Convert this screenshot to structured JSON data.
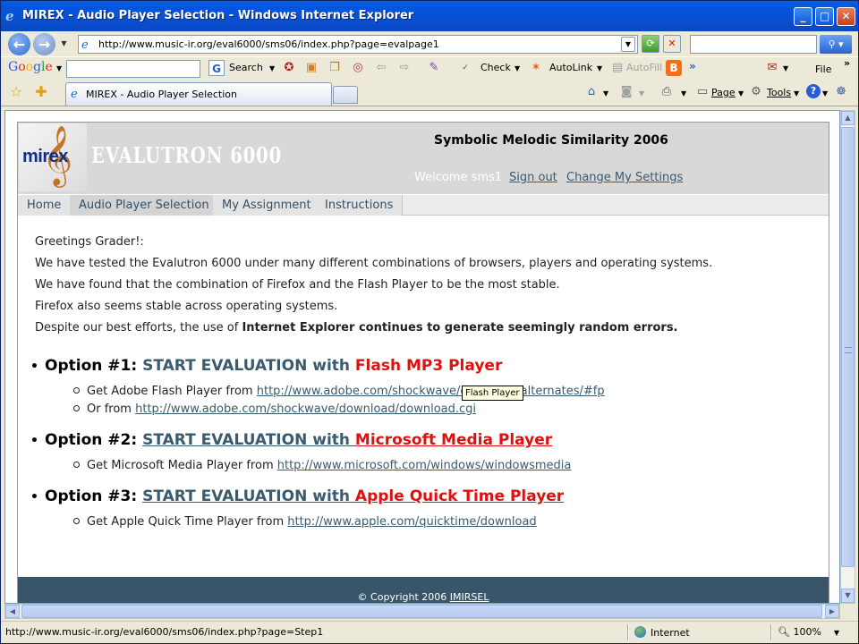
{
  "window": {
    "title": "MIREX - Audio Player Selection - Windows Internet Explorer"
  },
  "address_bar": {
    "url": "http://www.music-ir.org/eval6000/sms06/index.php?page=evalpage1"
  },
  "google_toolbar": {
    "logo": "Google",
    "search_label": "Search",
    "check_label": "Check",
    "autolink_label": "AutoLink",
    "autofill_label": "AutoFill",
    "more": "»",
    "file_label": "File"
  },
  "tabs": {
    "active_tab_label": "MIREX - Audio Player Selection"
  },
  "commands": {
    "page_label": "Page",
    "tools_label": "Tools"
  },
  "site": {
    "logo_text": "mirex",
    "brand": "EVALUTRON 6000",
    "title": "Symbolic Melodic Similarity 2006",
    "welcome": "Welcome sms1",
    "sign_out": "Sign out",
    "change_settings": "Change My Settings",
    "nav": [
      "Home",
      "Audio Player Selection",
      "My Assignment",
      "Instructions"
    ]
  },
  "content": {
    "greeting": "Greetings Grader!:",
    "line1": "We have tested the Evalutron 6000 under many different combinations of browsers, players and operating systems.",
    "line2": "We have found that the combination of Firefox and the Flash Player to be the most stable.",
    "line3": "Firefox also seems stable across operating systems.",
    "line4_prefix": "Despite our best efforts, the use of ",
    "line4_bold": "Internet Explorer continues to generate seemingly random errors.",
    "option1": {
      "label": "Option #1: ",
      "start": "START EVALUATION with ",
      "player": "Flash MP3 Player",
      "sub1_text": "Get Adobe Flash Player from ",
      "sub1_link": "http://www.adobe.com/shockwave/download/alternates/#fp",
      "sub2_text": "Or from ",
      "sub2_link": "http://www.adobe.com/shockwave/download/download.cgi"
    },
    "option2": {
      "label": "Option #2: ",
      "start": "START EVALUATION with ",
      "player": "Microsoft Media Player",
      "sub1_text": "Get Microsoft Media Player from ",
      "sub1_link": "http://www.microsoft.com/windows/windowsmedia"
    },
    "option3": {
      "label": "Option #3: ",
      "start": "START EVALUATION with ",
      "player": "Apple Quick Time Player",
      "sub1_text": "Get Apple Quick Time Player from ",
      "sub1_link": "http://www.apple.com/quicktime/download"
    },
    "tooltip": "Flash Player"
  },
  "footer": {
    "copyright": "© Copyright 2006 ",
    "org": "IMIRSEL"
  },
  "status_bar": {
    "url": "http://www.music-ir.org/eval6000/sms06/index.php?page=Step1",
    "zone": "Internet",
    "zoom": "100%"
  }
}
